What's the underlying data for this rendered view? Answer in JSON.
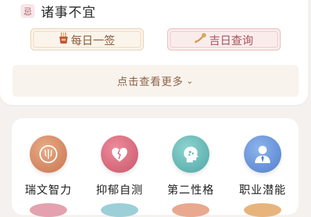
{
  "fortune": {
    "avoid_badge": "忌",
    "avoid_text": "诸事不宜"
  },
  "buttons": {
    "daily_sign": "每日一签",
    "lucky_day": "吉日查询"
  },
  "more": {
    "label": "点击查看更多",
    "chevron": "⌄"
  },
  "tools": [
    {
      "label": "瑞文智力",
      "icon": "brain-icon"
    },
    {
      "label": "抑郁自测",
      "icon": "broken-heart-icon"
    },
    {
      "label": "第二性格",
      "icon": "personality-head-icon"
    },
    {
      "label": "职业潜能",
      "icon": "businessman-icon"
    }
  ],
  "colors": {
    "avoid_badge_bg": "#f7e6e8",
    "sign_button": "#fbf4ea",
    "lucky_button": "#fbecec",
    "more_bar": "#f8f3ec",
    "tool_1": "#d8855f",
    "tool_2": "#dd6d80",
    "tool_3": "#6bbcba",
    "tool_4": "#6a96dc"
  }
}
